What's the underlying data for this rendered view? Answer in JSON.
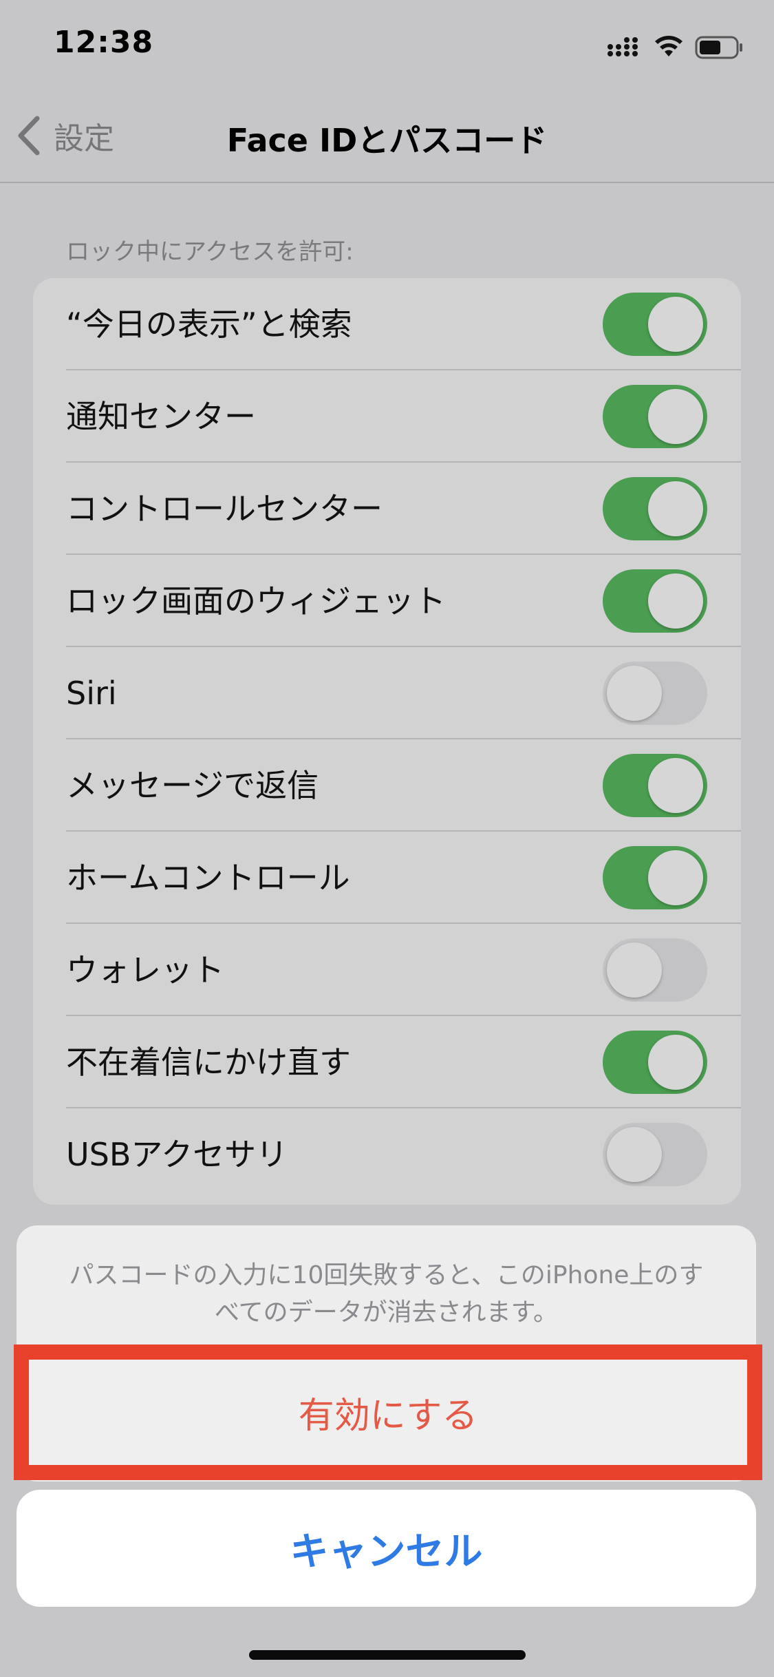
{
  "status_bar": {
    "time": "12:38"
  },
  "nav": {
    "back_label": "設定",
    "title": "Face IDとパスコード"
  },
  "section": {
    "header": "ロック中にアクセスを許可:"
  },
  "rows": [
    {
      "label": "“今日の表示”と検索",
      "on": true
    },
    {
      "label": "通知センター",
      "on": true
    },
    {
      "label": "コントロールセンター",
      "on": true
    },
    {
      "label": "ロック画面のウィジェット",
      "on": true
    },
    {
      "label": "Siri",
      "on": false
    },
    {
      "label": "メッセージで返信",
      "on": true
    },
    {
      "label": "ホームコントロール",
      "on": true
    },
    {
      "label": "ウォレット",
      "on": false
    },
    {
      "label": "不在着信にかけ直す",
      "on": true
    },
    {
      "label": "USBアクセサリ",
      "on": false
    }
  ],
  "action_sheet": {
    "message": "パスコードの入力に10回失敗すると、このiPhone上のすべてのデータが消去されます。",
    "enable_label": "有効にする",
    "cancel_label": "キャンセル"
  },
  "colors": {
    "toggle_on": "#4b9d51",
    "destructive": "#e55a47",
    "highlight": "#e8412c",
    "cancel": "#2f7be6"
  }
}
